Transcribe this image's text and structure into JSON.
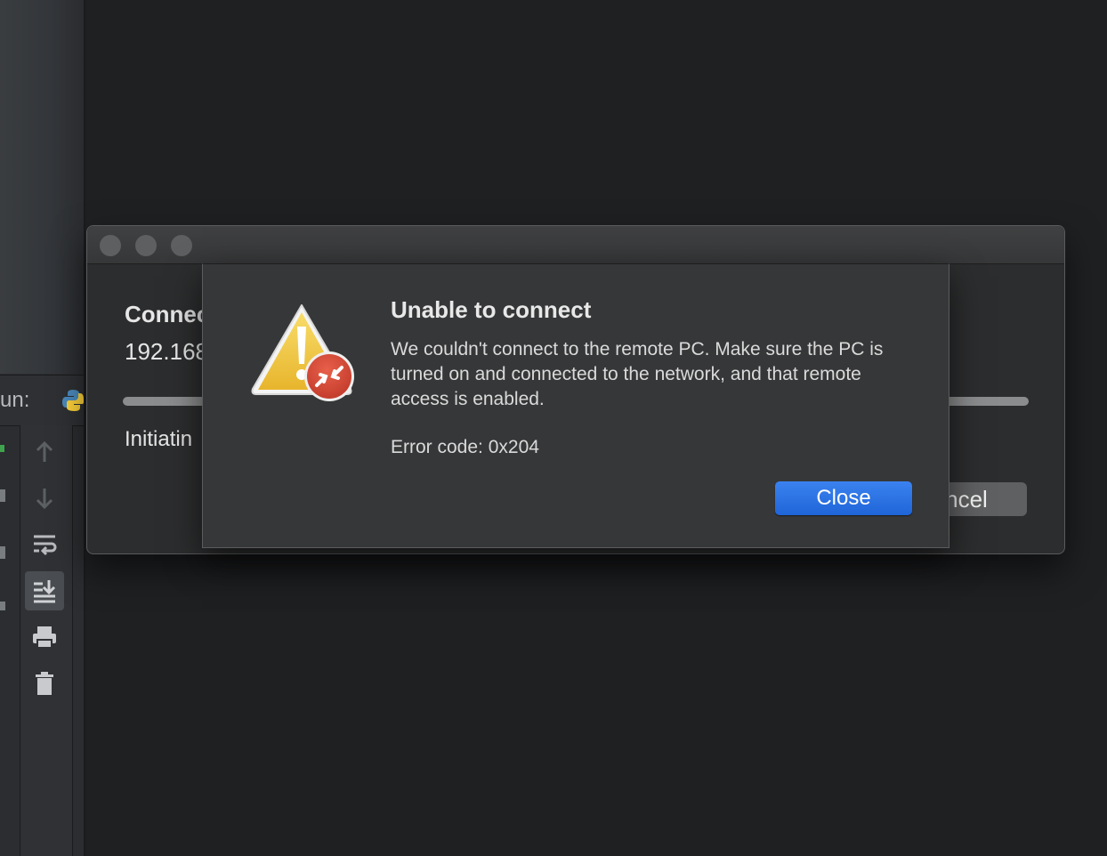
{
  "ide": {
    "run_label": "un:",
    "python_icon": "python-icon",
    "tools": [
      {
        "icon": "arrow-up-icon"
      },
      {
        "icon": "arrow-down-icon"
      },
      {
        "icon": "soft-wrap-icon"
      },
      {
        "icon": "scroll-to-end-icon",
        "active": true
      },
      {
        "icon": "print-icon"
      },
      {
        "icon": "trash-icon"
      }
    ]
  },
  "connection_window": {
    "title": "Connec",
    "host": "192.168",
    "status": "Initiatin",
    "cancel_label": "ncel"
  },
  "alert": {
    "icon": "warning-remote-desktop-icon",
    "title": "Unable to connect",
    "message": "We couldn't connect to the remote PC. Make sure the PC is turned on and connected to the network, and that remote access is enabled.",
    "error_code": "Error code: 0x204",
    "close_label": "Close"
  },
  "colors": {
    "background": "#1f2022",
    "dialog": "#363738",
    "primary_button": "#2a6fe4",
    "warning_yellow": "#f2c744",
    "badge_red": "#d64a36"
  }
}
